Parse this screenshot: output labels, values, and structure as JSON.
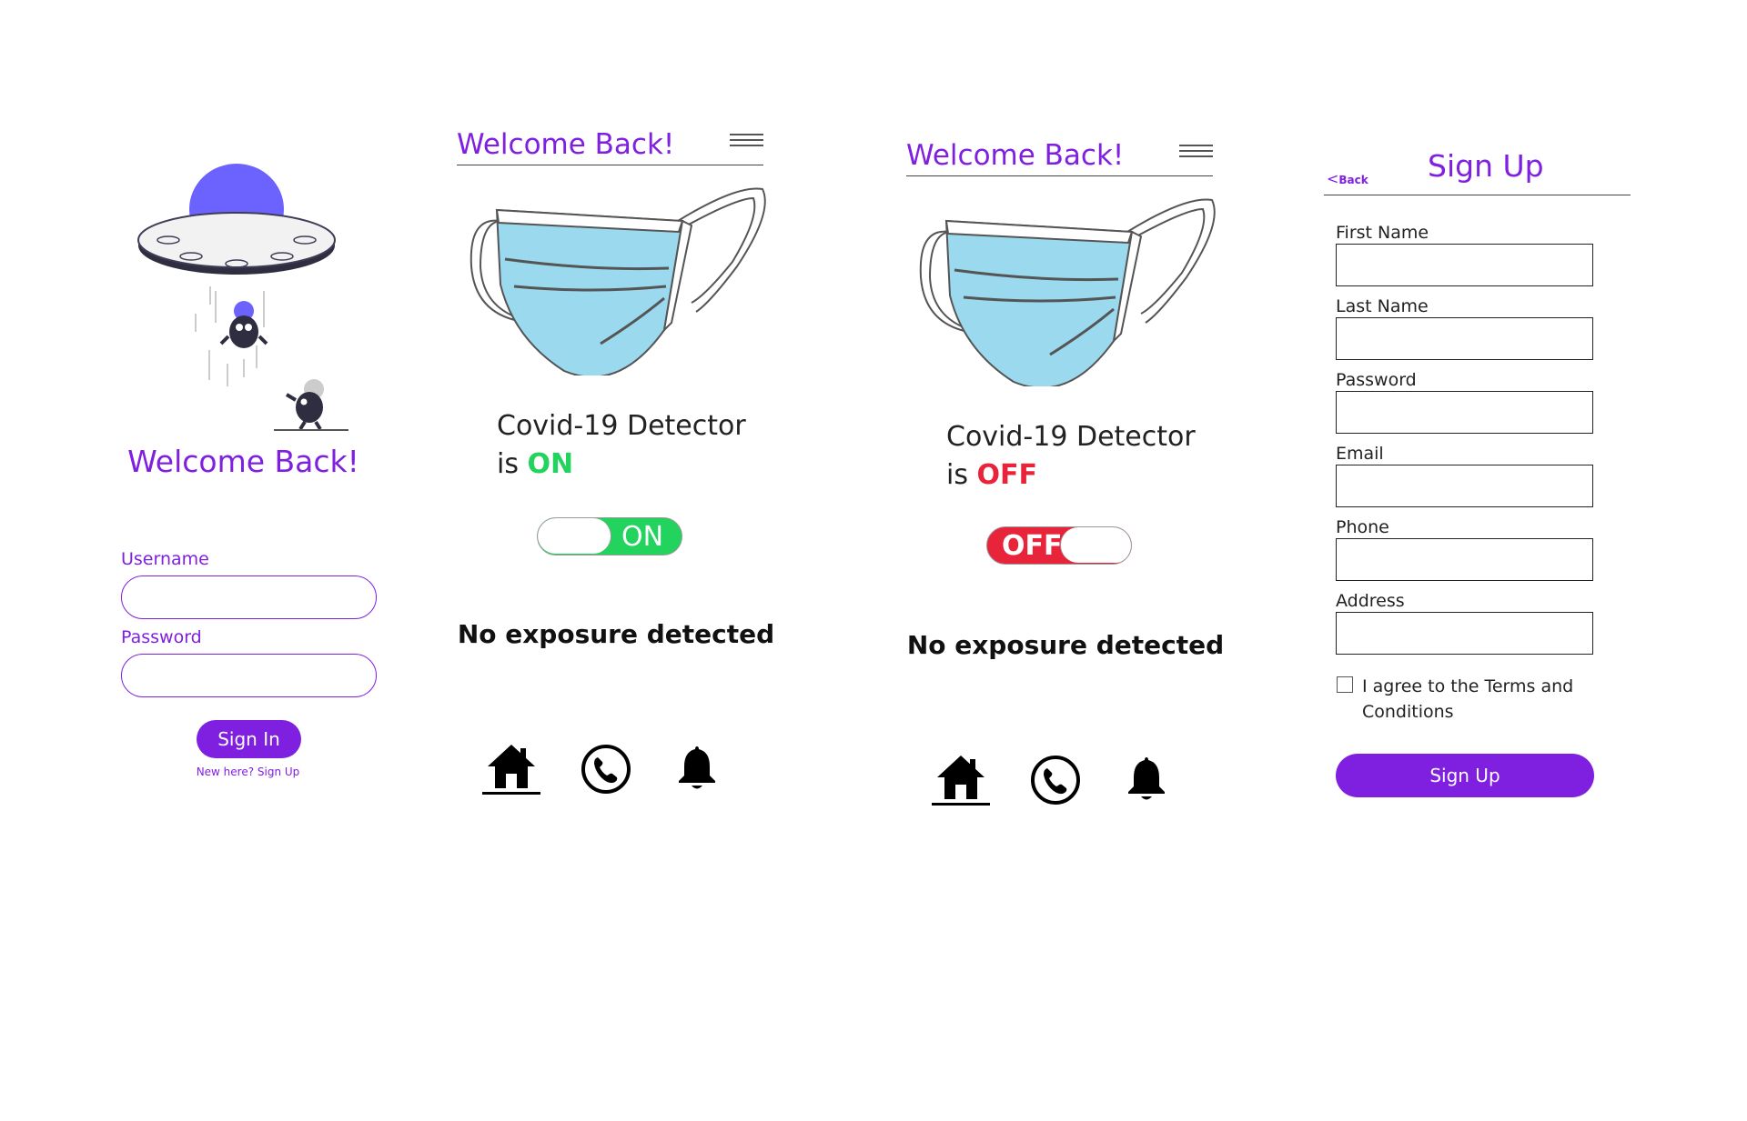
{
  "login": {
    "welcome": "Welcome Back!",
    "username_label": "Username",
    "password_label": "Password",
    "signin_label": "Sign In",
    "signup_link": "New here? Sign Up"
  },
  "detector_on": {
    "title": "Welcome Back!",
    "line1": "Covid-19 Detector",
    "line2_prefix": "is",
    "status": "ON",
    "toggle_label": "ON",
    "exposure": "No exposure detected"
  },
  "detector_off": {
    "title": "Welcome Back!",
    "line1": "Covid-19 Detector",
    "line2_prefix": "is",
    "status": "OFF",
    "toggle_label": "OFF",
    "exposure": "No exposure detected"
  },
  "signup": {
    "back": "Back",
    "title": "Sign Up",
    "fields": [
      "First Name",
      "Last Name",
      "Password",
      "Email",
      "Phone",
      "Address"
    ],
    "agree": "I agree to the Terms and Conditions",
    "button": "Sign Up"
  },
  "nav": {
    "icons": [
      "home-icon",
      "phone-icon",
      "bell-icon"
    ]
  },
  "colors": {
    "accent": "#7f1fe0",
    "on": "#22d35e",
    "off": "#e8243a",
    "mask": "#9bd9ee"
  }
}
